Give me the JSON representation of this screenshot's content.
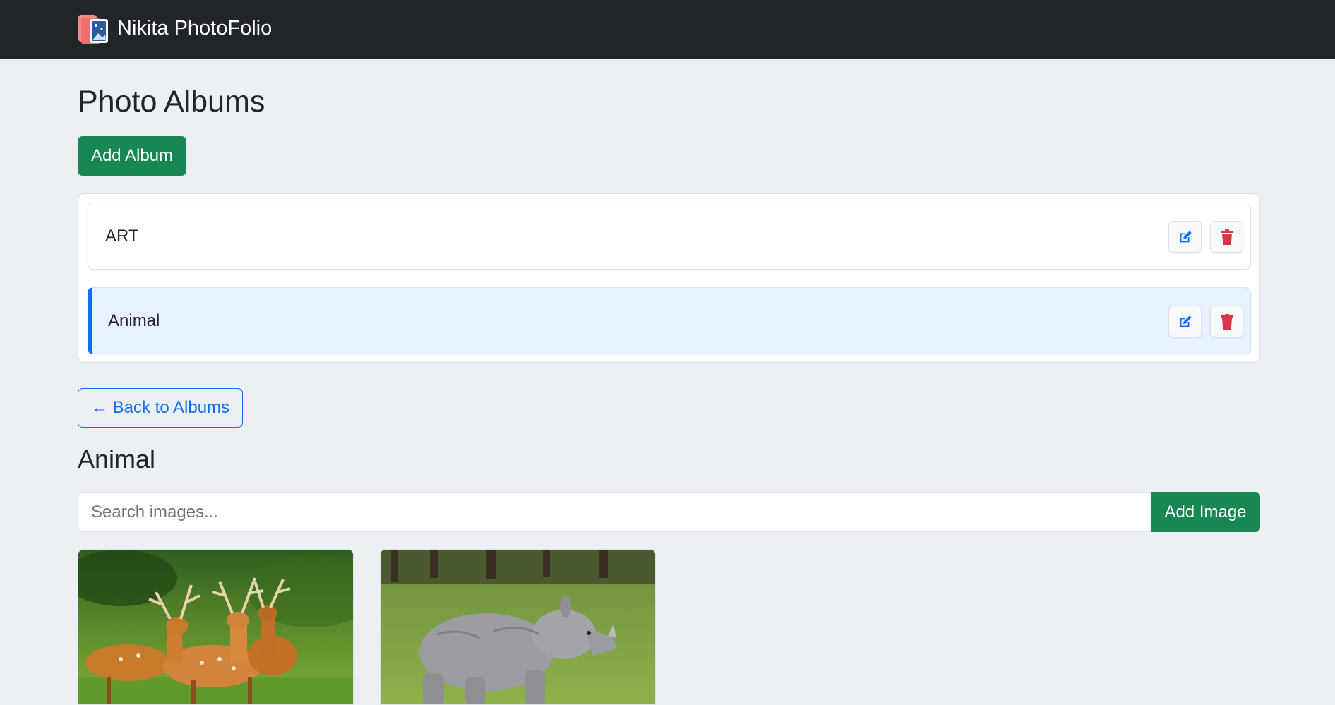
{
  "navbar": {
    "brand_name": "Nikita PhotoFolio",
    "logo_icon": "photo-album-icon"
  },
  "page": {
    "title": "Photo Albums",
    "add_album_label": "Add Album"
  },
  "albums": [
    {
      "name": "ART",
      "active": false,
      "edit_icon": "edit-icon",
      "delete_icon": "trash-icon"
    },
    {
      "name": "Animal",
      "active": true,
      "edit_icon": "edit-icon",
      "delete_icon": "trash-icon"
    }
  ],
  "album_view": {
    "back_label": "← Back to Albums",
    "heading": "Animal",
    "search_placeholder": "Search images...",
    "add_image_label": "Add Image",
    "images": [
      {
        "subject": "deer herd"
      },
      {
        "subject": "rhinoceros"
      }
    ]
  },
  "colors": {
    "navbar_bg": "#212529",
    "page_bg": "#eceff4",
    "success": "#198754",
    "primary": "#0d6efd",
    "danger": "#dc3545",
    "active_album_bg": "#e7f1ff"
  }
}
